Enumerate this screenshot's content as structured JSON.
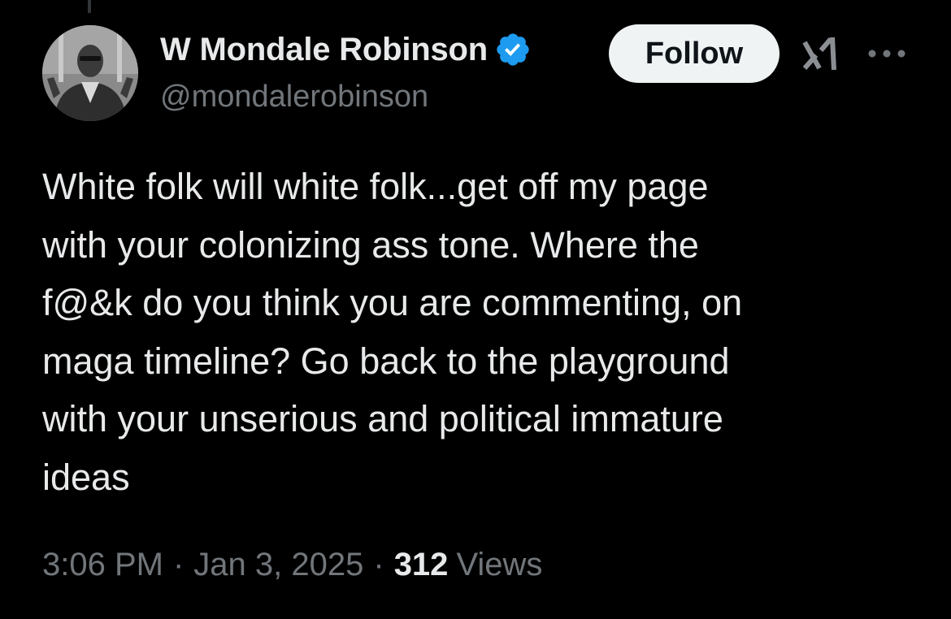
{
  "author": {
    "display_name": "W Mondale Robinson",
    "handle": "@mondalerobinson",
    "verified": true,
    "verified_color": "#1d9bf0",
    "avatar_icon": "profile-photo"
  },
  "actions": {
    "follow_label": "Follow",
    "grok_icon": "grok-icon",
    "more_icon": "more-horizontal-icon"
  },
  "tweet": {
    "text": "White folk will white folk...get off my page\nwith your colonizing ass tone. Where the\nf@&k do you think you are commenting, on\nmaga timeline? Go back to the playground\nwith your unserious and political immature\nideas"
  },
  "meta": {
    "time": "3:06 PM",
    "separator": "·",
    "date": "Jan 3, 2025",
    "views_count": "312",
    "views_label": "Views"
  },
  "colors": {
    "background": "#000000",
    "primary_text": "#e7e9ea",
    "secondary_text": "#71767b",
    "follow_bg": "#eff3f4"
  }
}
